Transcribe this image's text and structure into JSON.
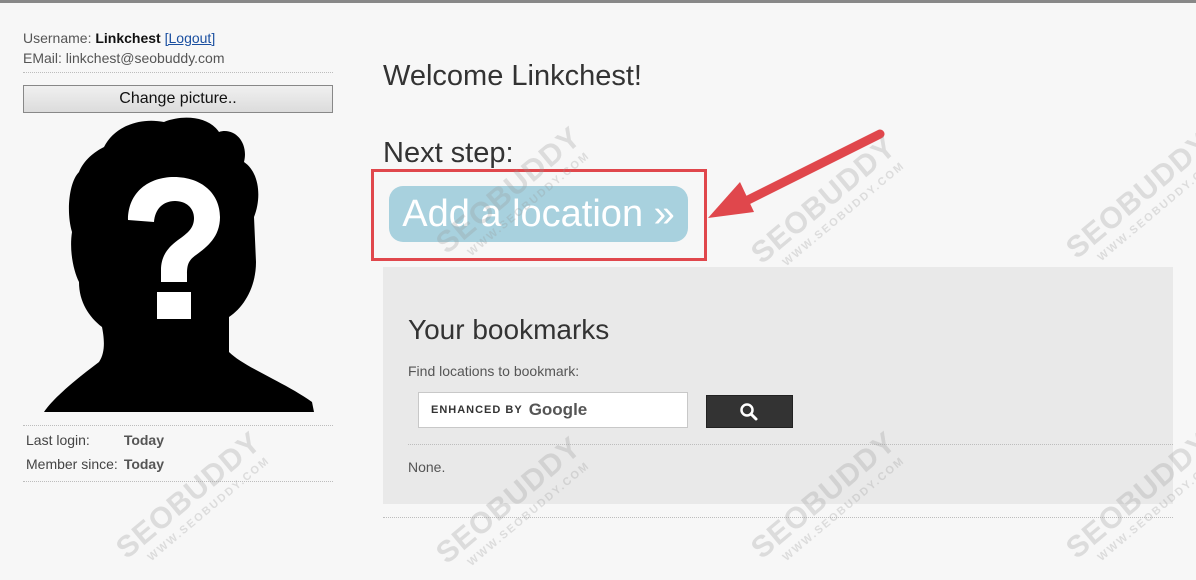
{
  "sidebar": {
    "username_label": "Username:",
    "username": "Linkchest",
    "logout_link": "[Logout]",
    "email_label": "EMail:",
    "email": "linkchest@seobuddy.com",
    "change_picture": "Change picture..",
    "stats": [
      {
        "label": "Last login:",
        "value": "Today"
      },
      {
        "label": "Member since:",
        "value": "Today"
      }
    ]
  },
  "main": {
    "welcome": "Welcome Linkchest!",
    "next_step": "Next step:",
    "add_location": "Add a location »"
  },
  "bookmarks": {
    "title": "Your bookmarks",
    "find_label": "Find locations to bookmark:",
    "search_enhanced": "ENHANCED BY",
    "search_brand": "Google",
    "none": "None."
  },
  "watermark": {
    "brand": "SEOBUDDY",
    "url": "WWW.SEOBUDDY.COM"
  },
  "icons": {
    "avatar": "silhouette-question-icon",
    "search": "magnifier-icon",
    "arrow": "red-arrow-icon"
  },
  "colors": {
    "add_button": "#a8d1de",
    "highlight": "#e0474c",
    "link": "#1a4fa0"
  }
}
